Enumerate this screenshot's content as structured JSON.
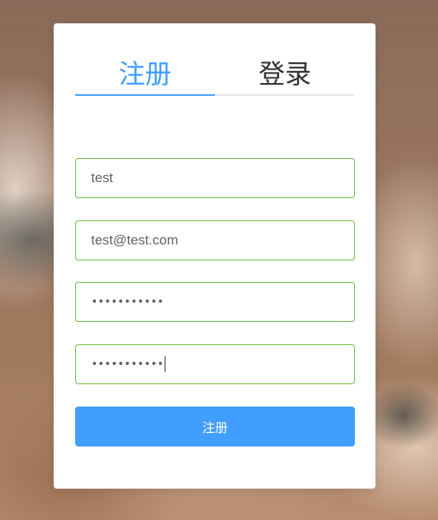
{
  "tabs": [
    {
      "label": "注册",
      "active": true
    },
    {
      "label": "登录",
      "active": false
    }
  ],
  "form": {
    "username_value": "test",
    "email_value": "test@test.com",
    "password_masked": "•••••••••••",
    "confirm_password_masked": "•••••••••••"
  },
  "submit_label": "注册",
  "colors": {
    "accent": "#409eff",
    "valid_border": "#67c23a"
  }
}
